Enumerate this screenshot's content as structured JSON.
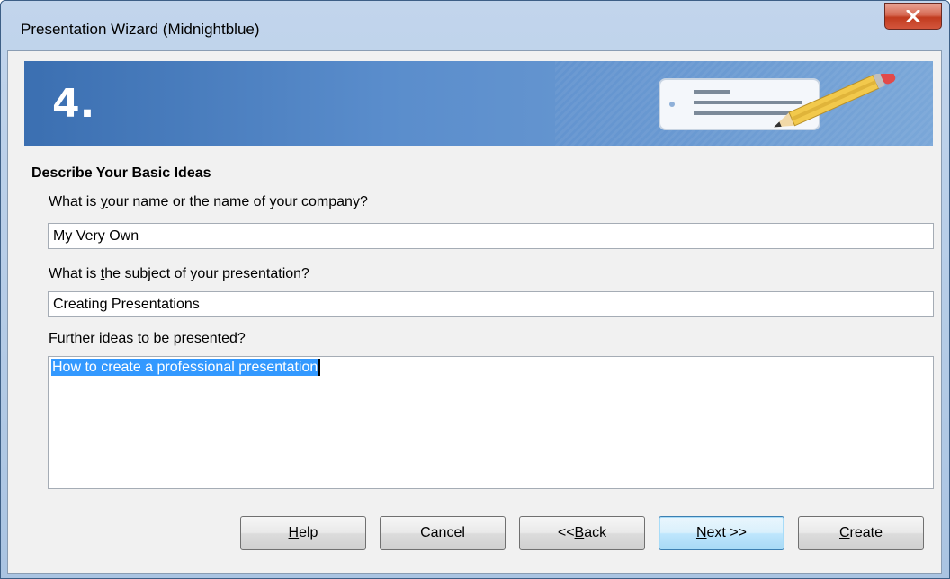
{
  "window": {
    "title": "Presentation Wizard (Midnightblue)",
    "close_glyph": "x"
  },
  "banner": {
    "step_number": "4.",
    "icon": "notepad-pencil-icon"
  },
  "section": {
    "title": "Describe Your Basic Ideas"
  },
  "fields": {
    "name_label_pre": "What is ",
    "name_label_mnemonic": "y",
    "name_label_post": "our name or the name of your company?",
    "name_value": "My Very Own",
    "subject_label_pre": "What is ",
    "subject_label_mnemonic": "t",
    "subject_label_post": "he subject of your presentation?",
    "subject_value": "Creating Presentations",
    "ideas_label": "Further ideas to be presented?",
    "ideas_value": "How to create a professional presentation"
  },
  "buttons": {
    "help_mnemonic": "H",
    "help_rest": "elp",
    "cancel": "Cancel",
    "back_pre": "<< ",
    "back_mnemonic": "B",
    "back_rest": "ack",
    "next_mnemonic": "N",
    "next_rest": "ext >>",
    "create_mnemonic": "C",
    "create_rest": "reate"
  },
  "colors": {
    "banner": "#3b6fb1",
    "selection": "#3399ff",
    "close_button": "#c13b1f"
  }
}
